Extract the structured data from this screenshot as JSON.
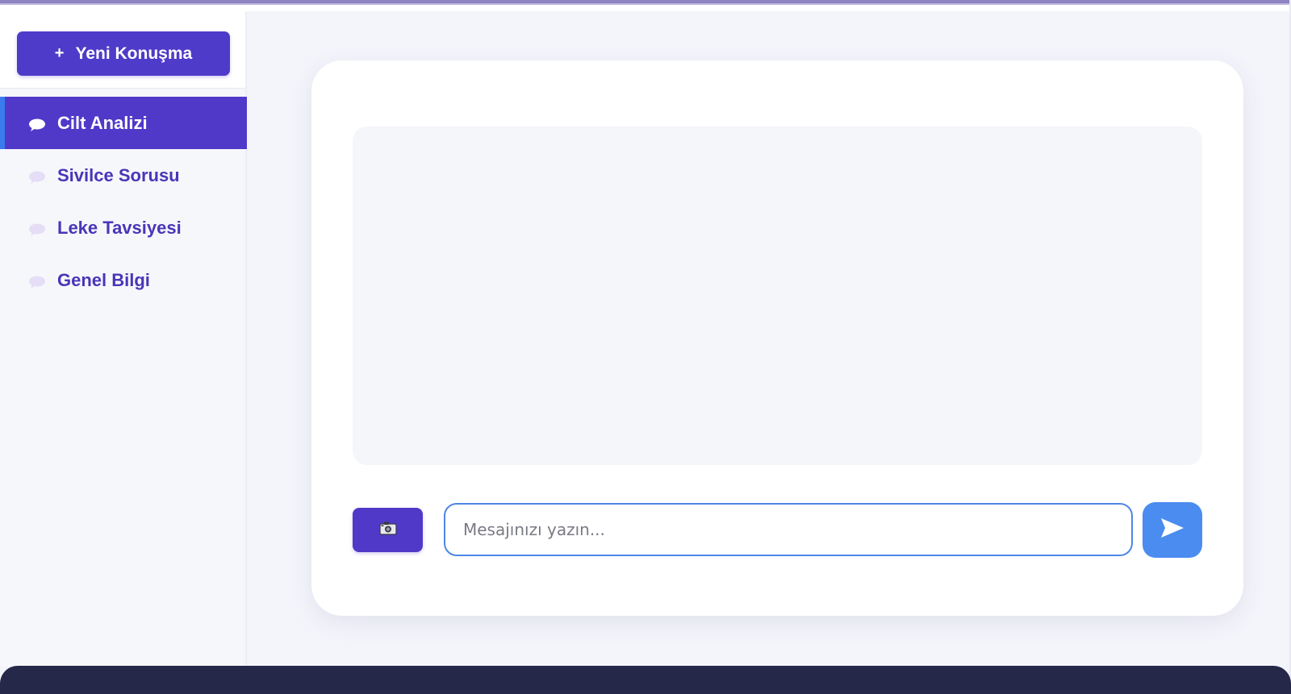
{
  "sidebar": {
    "new_chat_label": "Yeni Konuşma",
    "new_chat_icon": "plus-icon",
    "conversations": [
      {
        "label": "Cilt Analizi",
        "icon": "speech-bubble-icon",
        "active": true
      },
      {
        "label": "Sivilce Sorusu",
        "icon": "speech-bubble-icon",
        "active": false
      },
      {
        "label": "Leke Tavsiyesi",
        "icon": "speech-bubble-icon",
        "active": false
      },
      {
        "label": "Genel Bilgi",
        "icon": "speech-bubble-icon",
        "active": false
      }
    ]
  },
  "composer": {
    "camera_icon": "camera-icon",
    "placeholder": "Mesajınızı yazın...",
    "value": "",
    "send_icon": "send-icon"
  },
  "colors": {
    "primary": "#5039c8",
    "accent_blue": "#4a8cf0",
    "active_marker": "#3a7bf0",
    "footer": "#252848"
  }
}
